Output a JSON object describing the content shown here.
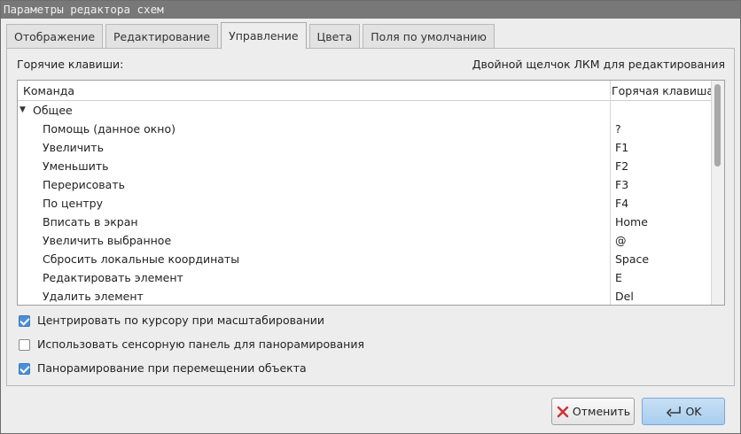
{
  "window": {
    "title": "Параметры редактора схем"
  },
  "tabs": [
    {
      "label": "Отображение",
      "active": false
    },
    {
      "label": "Редактирование",
      "active": false
    },
    {
      "label": "Управление",
      "active": true
    },
    {
      "label": "Цвета",
      "active": false
    },
    {
      "label": "Поля по умолчанию",
      "active": false
    }
  ],
  "panel": {
    "hotkeys_label": "Горячие клавиши:",
    "hint": "Двойной щелчок ЛКМ для редактирования"
  },
  "tree": {
    "columns": {
      "command": "Команда",
      "hotkey": "Горячая клавиша"
    },
    "group": "Общее",
    "rows": [
      {
        "command": "Помощь (данное окно)",
        "hotkey": "?"
      },
      {
        "command": "Увеличить",
        "hotkey": "F1"
      },
      {
        "command": "Уменьшить",
        "hotkey": "F2"
      },
      {
        "command": "Перерисовать",
        "hotkey": "F3"
      },
      {
        "command": "По центру",
        "hotkey": "F4"
      },
      {
        "command": "Вписать в экран",
        "hotkey": "Home"
      },
      {
        "command": "Увеличить выбранное",
        "hotkey": "@"
      },
      {
        "command": "Сбросить локальные координаты",
        "hotkey": "Space"
      },
      {
        "command": "Редактировать элемент",
        "hotkey": "E"
      },
      {
        "command": "Удалить элемент",
        "hotkey": "Del"
      }
    ]
  },
  "options": [
    {
      "label": "Центрировать по курсору при масштабировании",
      "checked": true
    },
    {
      "label": "Использовать сенсорную панель для панорамирования",
      "checked": false
    },
    {
      "label": "Панорамирование при перемещении объекта",
      "checked": true
    }
  ],
  "buttons": {
    "cancel": {
      "label": "Отменить",
      "icon": "cancel-icon"
    },
    "ok": {
      "label": "OK",
      "icon": "enter-icon"
    }
  },
  "colors": {
    "accent": "#4a90d9",
    "titlebar": "#787878",
    "cancel_icon": "#d03030"
  }
}
